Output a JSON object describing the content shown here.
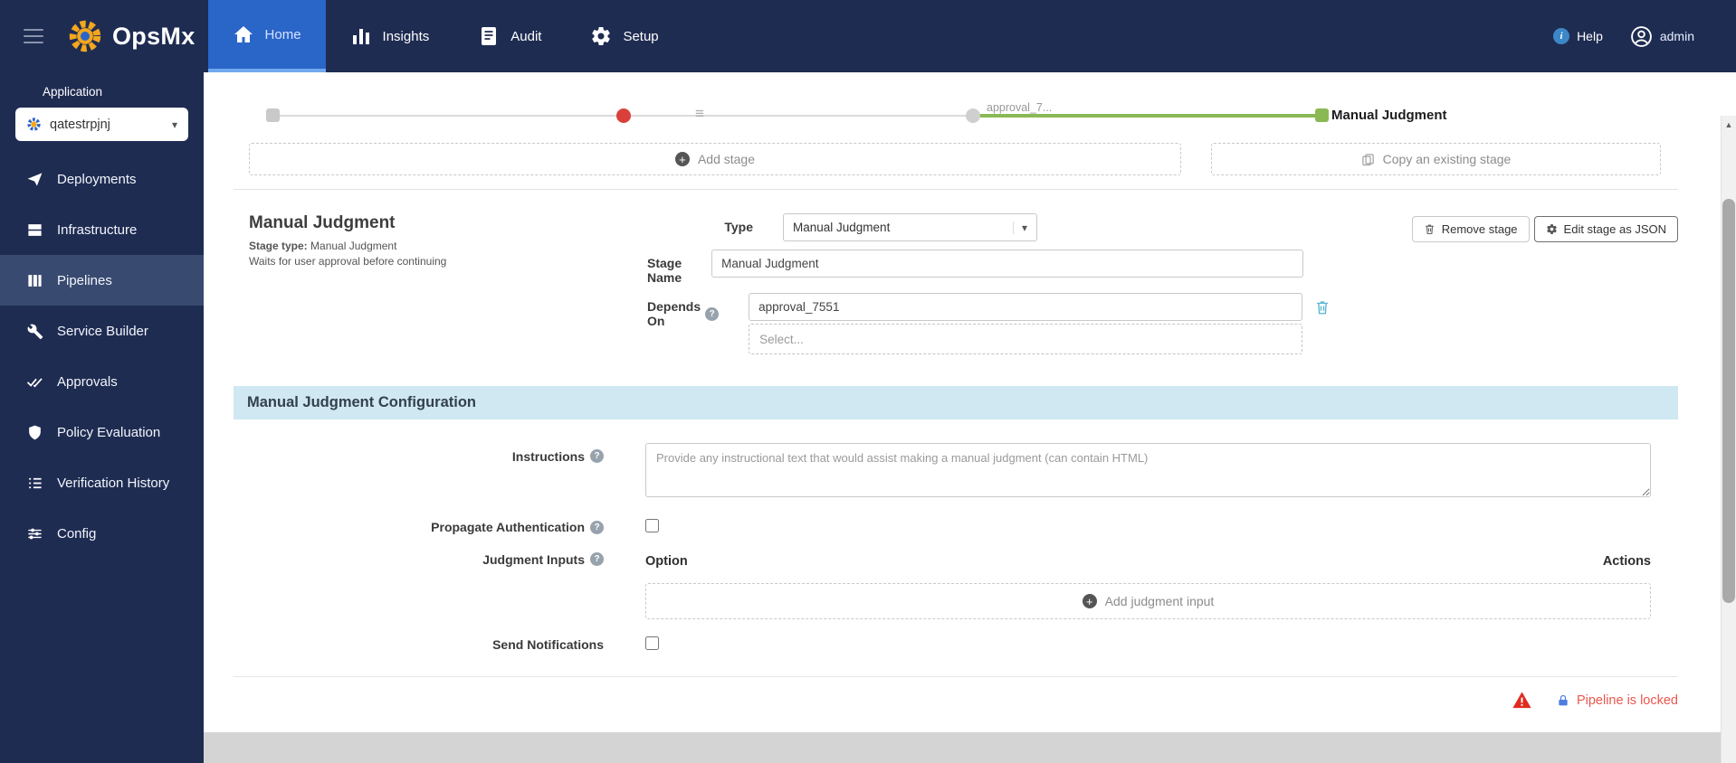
{
  "navbar": {
    "brand": "OpsMx",
    "tabs": [
      {
        "label": "Home"
      },
      {
        "label": "Insights"
      },
      {
        "label": "Audit"
      },
      {
        "label": "Setup"
      }
    ],
    "help_label": "Help",
    "user_label": "admin"
  },
  "sidebar": {
    "section_label": "Application",
    "application_name": "qatestrpjnj",
    "active_item": "Pipelines",
    "items": [
      {
        "label": "Deployments"
      },
      {
        "label": "Infrastructure"
      },
      {
        "label": "Pipelines"
      },
      {
        "label": "Service Builder"
      },
      {
        "label": "Approvals"
      },
      {
        "label": "Policy Evaluation"
      },
      {
        "label": "Verification History"
      },
      {
        "label": "Config"
      }
    ]
  },
  "graph": {
    "upstream_stage_label": "approval_7...",
    "selected_stage_label": "Manual Judgment"
  },
  "stage_actions": {
    "add_stage": "Add stage",
    "copy_existing": "Copy an existing stage"
  },
  "stage": {
    "title": "Manual Judgment",
    "stage_type_label": "Stage type:",
    "stage_type_value": "Manual Judgment",
    "description": "Waits for user approval before continuing",
    "remove_stage": "Remove stage",
    "edit_json": "Edit stage as JSON",
    "type_label": "Type",
    "type_value": "Manual Judgment",
    "name_label": "Stage Name",
    "name_value": "Manual Judgment",
    "depends_label": "Depends On",
    "depends_value": "approval_7551",
    "depends_placeholder": "Select..."
  },
  "config": {
    "title": "Manual Judgment Configuration",
    "instructions_label": "Instructions",
    "instructions_placeholder": "Provide any instructional text that would assist making a manual judgment (can contain HTML)",
    "propagate_label": "Propagate Authentication",
    "judgment_inputs_label": "Judgment Inputs",
    "option_header": "Option",
    "actions_header": "Actions",
    "add_judgment_input": "Add judgment input",
    "send_notifications_label": "Send Notifications"
  },
  "footer": {
    "locked_label": "Pipeline is locked"
  },
  "colors": {
    "navbar_bg": "#1f2c52",
    "active_tab_blue": "#2a65c8",
    "section_header_bg": "#cfe8f2",
    "locked_text_red": "#e8584e",
    "selected_stage_green": "#8ab954",
    "failed_stage_red": "#d9403a",
    "depends_delete_blue": "#56b4d3"
  }
}
